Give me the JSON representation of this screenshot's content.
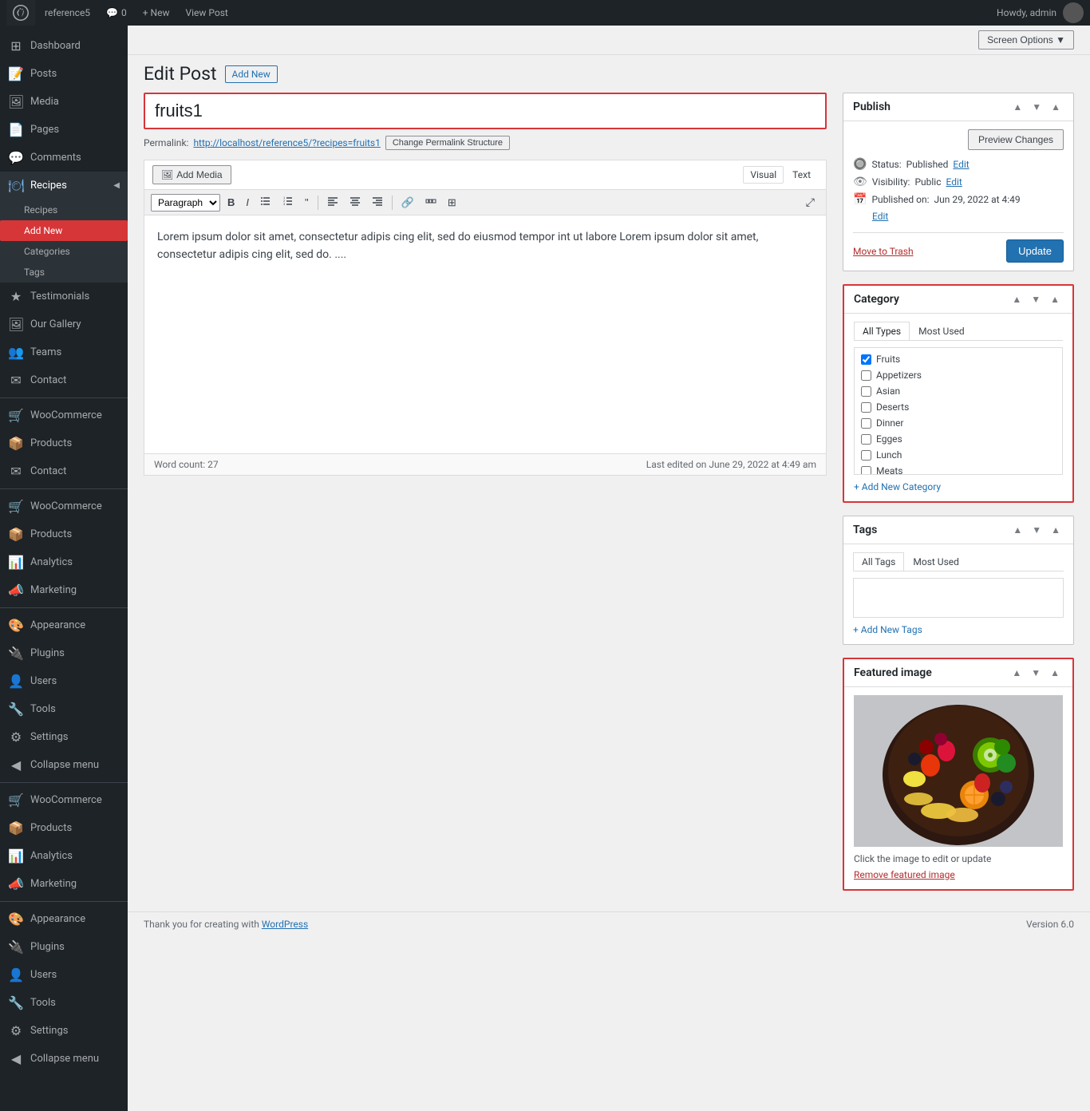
{
  "adminbar": {
    "site_name": "reference5",
    "comments_count": "0",
    "new_label": "+ New",
    "view_post_label": "View Post",
    "howdy": "Howdy, admin"
  },
  "screen_options": {
    "label": "Screen Options ▼"
  },
  "page": {
    "title": "Edit Post",
    "add_new_label": "Add New"
  },
  "post": {
    "title": "fruits1",
    "permalink_label": "Permalink:",
    "permalink_url": "http://localhost/reference5/?recipes=fruits1",
    "change_permalink_label": "Change Permalink Structure",
    "content": "Lorem ipsum dolor sit amet, consectetur adipis cing elit, sed do eiusmod tempor int ut labore Lorem ipsum dolor sit amet, consectetur adipis cing elit, sed do. ....",
    "word_count_label": "Word count: 27",
    "last_edited_label": "Last edited on June 29, 2022 at 4:49 am"
  },
  "editor": {
    "add_media_label": "Add Media",
    "add_media_icon": "🖼",
    "visual_label": "Visual",
    "text_label": "Text",
    "paragraph_label": "Paragraph",
    "bold_label": "B",
    "italic_label": "I",
    "ul_label": "≡",
    "ol_label": "≡",
    "blockquote_label": "\"",
    "align_left": "≡",
    "align_center": "≡",
    "align_right": "≡",
    "link_label": "🔗",
    "toolbar_label": "≡",
    "table_label": "⊞",
    "fullscreen_label": "⤢"
  },
  "publish": {
    "title": "Publish",
    "preview_changes_label": "Preview Changes",
    "status_label": "Status:",
    "status_value": "Published",
    "status_edit_label": "Edit",
    "visibility_label": "Visibility:",
    "visibility_value": "Public",
    "visibility_edit_label": "Edit",
    "published_on_label": "Published on:",
    "published_date": "Jun 29, 2022 at 4:49",
    "published_edit_label": "Edit",
    "move_to_trash_label": "Move to Trash",
    "update_label": "Update"
  },
  "category": {
    "title": "Category",
    "all_types_label": "All Types",
    "most_used_label": "Most Used",
    "items": [
      {
        "name": "Fruits",
        "checked": true
      },
      {
        "name": "Appetizers",
        "checked": false
      },
      {
        "name": "Asian",
        "checked": false
      },
      {
        "name": "Deserts",
        "checked": false
      },
      {
        "name": "Dinner",
        "checked": false
      },
      {
        "name": "Egges",
        "checked": false
      },
      {
        "name": "Lunch",
        "checked": false
      },
      {
        "name": "Meats",
        "checked": false
      }
    ],
    "add_new_label": "+ Add New Category"
  },
  "tags": {
    "title": "Tags",
    "all_tags_label": "All Tags",
    "most_used_label": "Most Used",
    "add_new_label": "+ Add New Tags"
  },
  "featured_image": {
    "title": "Featured image",
    "caption": "Click the image to edit or update",
    "remove_label": "Remove featured image"
  },
  "sidebar": {
    "items": [
      {
        "label": "Dashboard",
        "icon": "⊞",
        "name": "dashboard"
      },
      {
        "label": "Posts",
        "icon": "📝",
        "name": "posts"
      },
      {
        "label": "Media",
        "icon": "🖼",
        "name": "media"
      },
      {
        "label": "Pages",
        "icon": "📄",
        "name": "pages"
      },
      {
        "label": "Comments",
        "icon": "💬",
        "name": "comments"
      },
      {
        "label": "Recipes",
        "icon": "🍽",
        "name": "recipes"
      },
      {
        "label": "Recipes",
        "icon": "",
        "name": "recipes-sub",
        "type": "submenu"
      },
      {
        "label": "Add New",
        "icon": "",
        "name": "add-new-sub",
        "type": "submenu",
        "highlighted": true
      },
      {
        "label": "Categories",
        "icon": "",
        "name": "categories-sub",
        "type": "submenu"
      },
      {
        "label": "Tags",
        "icon": "",
        "name": "tags-sub",
        "type": "submenu"
      },
      {
        "label": "Testimonials",
        "icon": "★",
        "name": "testimonials"
      },
      {
        "label": "Our Gallery",
        "icon": "🖼",
        "name": "our-gallery"
      },
      {
        "label": "Teams",
        "icon": "👥",
        "name": "teams"
      },
      {
        "label": "Contact",
        "icon": "✉",
        "name": "contact"
      },
      {
        "label": "WooCommerce",
        "icon": "🛒",
        "name": "woocommerce1"
      },
      {
        "label": "Products",
        "icon": "📦",
        "name": "products1"
      },
      {
        "label": "Contact",
        "icon": "✉",
        "name": "contact2"
      },
      {
        "label": "WooCommerce",
        "icon": "🛒",
        "name": "woocommerce2"
      },
      {
        "label": "Products",
        "icon": "📦",
        "name": "products2"
      },
      {
        "label": "Analytics",
        "icon": "📊",
        "name": "analytics1"
      },
      {
        "label": "Marketing",
        "icon": "📣",
        "name": "marketing1"
      },
      {
        "label": "Appearance",
        "icon": "🎨",
        "name": "appearance1"
      },
      {
        "label": "Plugins",
        "icon": "🔌",
        "name": "plugins1"
      },
      {
        "label": "Users",
        "icon": "👤",
        "name": "users1"
      },
      {
        "label": "Tools",
        "icon": "🔧",
        "name": "tools1"
      },
      {
        "label": "Settings",
        "icon": "⚙",
        "name": "settings1"
      },
      {
        "label": "Collapse menu",
        "icon": "◀",
        "name": "collapse1"
      },
      {
        "label": "WooCommerce",
        "icon": "🛒",
        "name": "woocommerce3"
      },
      {
        "label": "Products",
        "icon": "📦",
        "name": "products3"
      },
      {
        "label": "Analytics",
        "icon": "📊",
        "name": "analytics2"
      },
      {
        "label": "Marketing",
        "icon": "📣",
        "name": "marketing2"
      },
      {
        "label": "Appearance",
        "icon": "🎨",
        "name": "appearance2"
      },
      {
        "label": "Plugins",
        "icon": "🔌",
        "name": "plugins2"
      },
      {
        "label": "Users",
        "icon": "👤",
        "name": "users2"
      },
      {
        "label": "Tools",
        "icon": "🔧",
        "name": "tools2"
      },
      {
        "label": "Settings",
        "icon": "⚙",
        "name": "settings2"
      },
      {
        "label": "Collapse menu",
        "icon": "◀",
        "name": "collapse2"
      }
    ]
  },
  "footer": {
    "thank_you_text": "Thank you for creating with",
    "wordpress_link": "WordPress",
    "version_label": "Version 6.0"
  }
}
